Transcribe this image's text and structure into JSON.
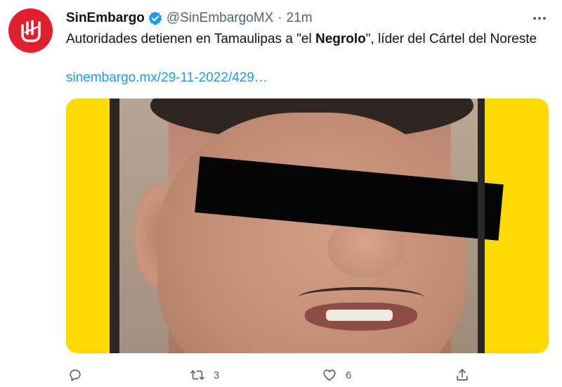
{
  "tweet": {
    "display_name": "SinEmbargo",
    "handle": "@SinEmbargoMX",
    "separator": "·",
    "time": "21m",
    "text_before": "Autoridades detienen en Tamaulipas a \"el ",
    "text_bold": "Negrolo",
    "text_after": "\", líder del Cártel del Noreste",
    "link": "sinembargo.mx/29-11-2022/429…"
  },
  "actions": {
    "reply_count": "",
    "retweet_count": "3",
    "like_count": "6"
  },
  "colors": {
    "avatar_bg": "#e0202e",
    "verified": "#1d9bf0",
    "link": "#1d9bf0",
    "media_bg": "#fed904",
    "muted_text": "#536471"
  },
  "icons": {
    "avatar": "sinembargo-logo",
    "verified": "verified-badge-icon",
    "more": "more-options-icon",
    "reply": "reply-icon",
    "retweet": "retweet-icon",
    "like": "heart-icon",
    "share": "share-icon"
  }
}
